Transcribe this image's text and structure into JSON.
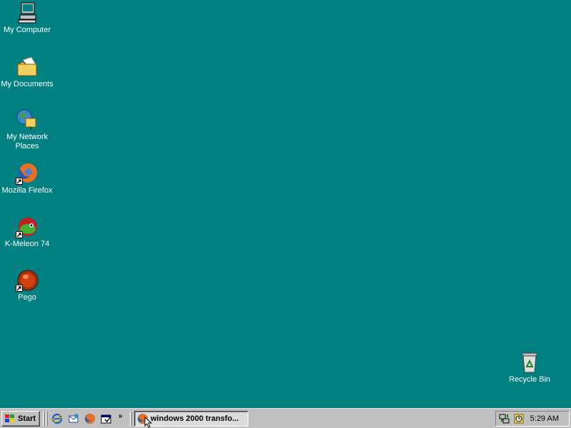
{
  "desktop": {
    "background_color": "#008080",
    "icons": [
      {
        "label": "My Computer",
        "icon": "computer-icon"
      },
      {
        "label": "My Documents",
        "icon": "documents-folder-icon"
      },
      {
        "label": "My Network Places",
        "icon": "network-places-icon"
      },
      {
        "label": "Mozilla Firefox",
        "icon": "firefox-icon"
      },
      {
        "label": "K-Meleon 74",
        "icon": "kmeleon-icon"
      },
      {
        "label": "Pego",
        "icon": "pego-icon"
      },
      {
        "label": "Recycle Bin",
        "icon": "recycle-bin-icon"
      }
    ]
  },
  "taskbar": {
    "start_label": "Start",
    "quick_launch": [
      "internet-explorer-icon",
      "outlook-express-icon",
      "firefox-icon",
      "show-desktop-icon"
    ],
    "overflow_label": "»",
    "tasks": [
      {
        "label": "windows 2000 transfo...",
        "icon": "firefox-icon",
        "active": true
      }
    ],
    "tray_icons": [
      "network-tray-icon",
      "scheduler-tray-icon"
    ],
    "clock": "5:29 AM"
  }
}
